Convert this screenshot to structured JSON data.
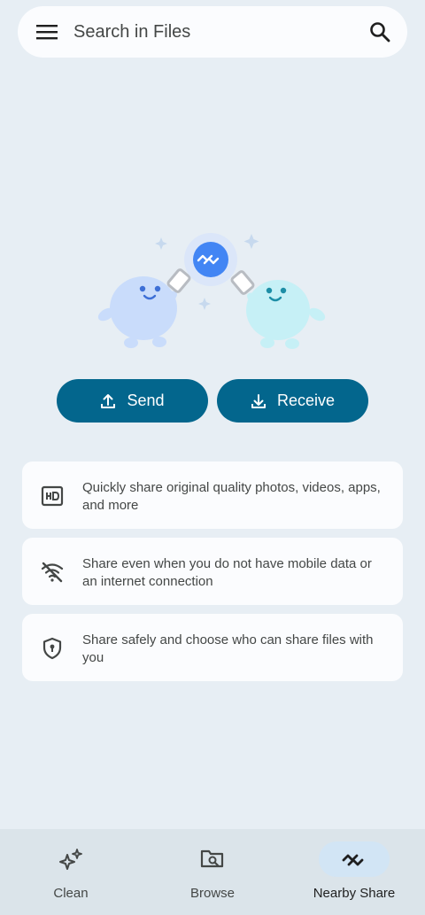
{
  "search": {
    "placeholder": "Search in Files"
  },
  "icons": {
    "menu": "menu-icon",
    "search": "search-icon",
    "nearby": "nearby-share-icon",
    "upload": "upload-icon",
    "download": "download-icon",
    "hd": "hd-icon",
    "no_wifi": "wifi-off-icon",
    "shield": "shield-lock-icon",
    "sparkle": "sparkle-icon",
    "browse": "folder-search-icon"
  },
  "actions": {
    "send_label": "Send",
    "receive_label": "Receive"
  },
  "features": [
    {
      "text": "Quickly share original quality photos, videos, apps, and more"
    },
    {
      "text": "Share even when you do not have mobile data or an internet connection"
    },
    {
      "text": "Share safely and choose who can share files with you"
    }
  ],
  "nav": {
    "items": [
      {
        "label": "Clean",
        "active": false
      },
      {
        "label": "Browse",
        "active": false
      },
      {
        "label": "Nearby Share",
        "active": true
      }
    ]
  },
  "colors": {
    "background": "#e7eef4",
    "button": "#03668d",
    "card": "#fbfcfe",
    "nav_background": "#dbe4ea",
    "active_pill": "#d2e5f5",
    "accent_blue": "#4285f4"
  }
}
